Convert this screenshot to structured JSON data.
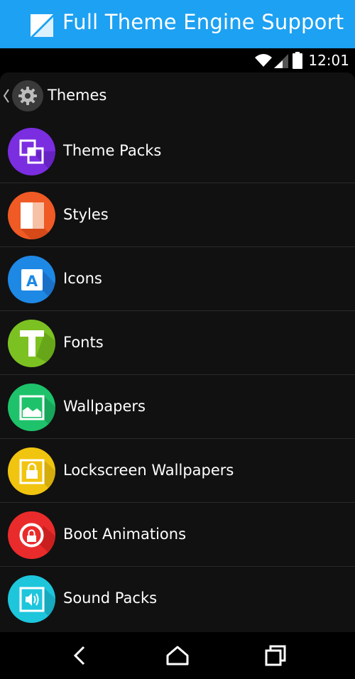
{
  "banner": {
    "title": "Full Theme Engine Support"
  },
  "status_bar": {
    "time": "12:01"
  },
  "header": {
    "title": "Themes"
  },
  "items": [
    {
      "label": "Theme Packs",
      "icon": "theme-packs-icon",
      "color": "#7b2de0"
    },
    {
      "label": "Styles",
      "icon": "styles-icon",
      "color": "#f05a24"
    },
    {
      "label": "Icons",
      "icon": "icons-icon",
      "color": "#1e88e5"
    },
    {
      "label": "Fonts",
      "icon": "fonts-icon",
      "color": "#7cc122"
    },
    {
      "label": "Wallpapers",
      "icon": "wallpapers-icon",
      "color": "#1ec26a"
    },
    {
      "label": "Lockscreen Wallpapers",
      "icon": "lockscreen-wallpapers-icon",
      "color": "#f1c40f"
    },
    {
      "label": "Boot Animations",
      "icon": "boot-animations-icon",
      "color": "#ea2b2b"
    },
    {
      "label": "Sound Packs",
      "icon": "sound-packs-icon",
      "color": "#1ec6dc"
    }
  ],
  "colors": {
    "banner": "#1da1f2",
    "panel": "#111111",
    "divider": "#2a2a2a"
  }
}
